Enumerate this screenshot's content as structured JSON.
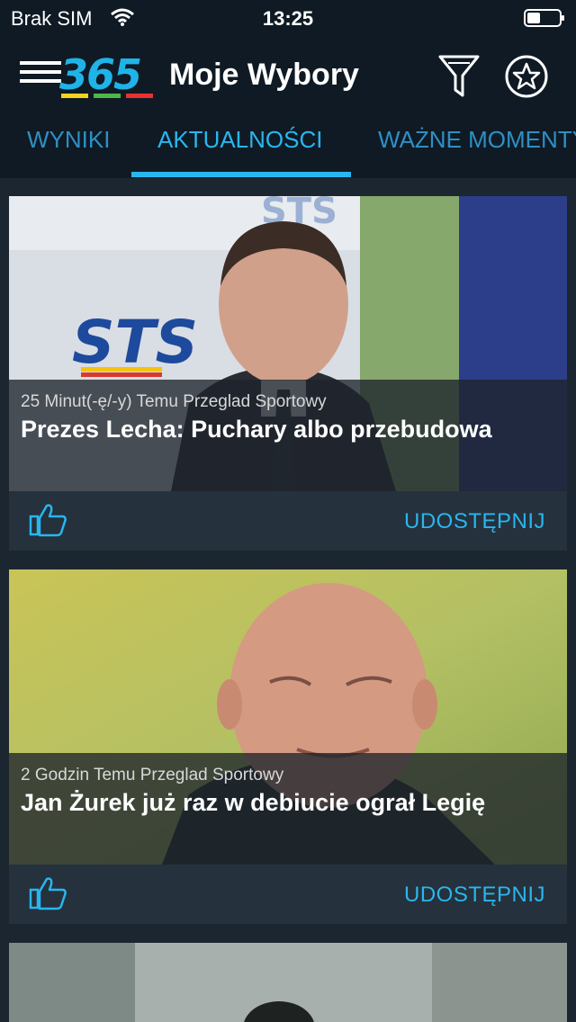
{
  "status_bar": {
    "carrier": "Brak SIM",
    "time": "13:25"
  },
  "header": {
    "logo_text": "365",
    "title": "Moje Wybory"
  },
  "tabs": [
    {
      "label": "WYNIKI",
      "active": false
    },
    {
      "label": "AKTUALNOŚCI",
      "active": true
    },
    {
      "label": "WAŻNE MOMENTY",
      "active": false
    }
  ],
  "articles": [
    {
      "meta": "25 Minut(-ę/-y) Temu Przeglad Sportowy",
      "headline": "Prezes Lecha: Puchary albo przebudowa",
      "share_label": "UDOSTĘPNIJ"
    },
    {
      "meta": "2 Godzin Temu Przeglad Sportowy",
      "headline": "Jan Żurek już raz w debiucie ograł Legię",
      "share_label": "UDOSTĘPNIJ"
    }
  ],
  "colors": {
    "accent": "#29b6ee",
    "background": "#1c2630",
    "header": "#0f1a24",
    "card": "#25313c"
  }
}
